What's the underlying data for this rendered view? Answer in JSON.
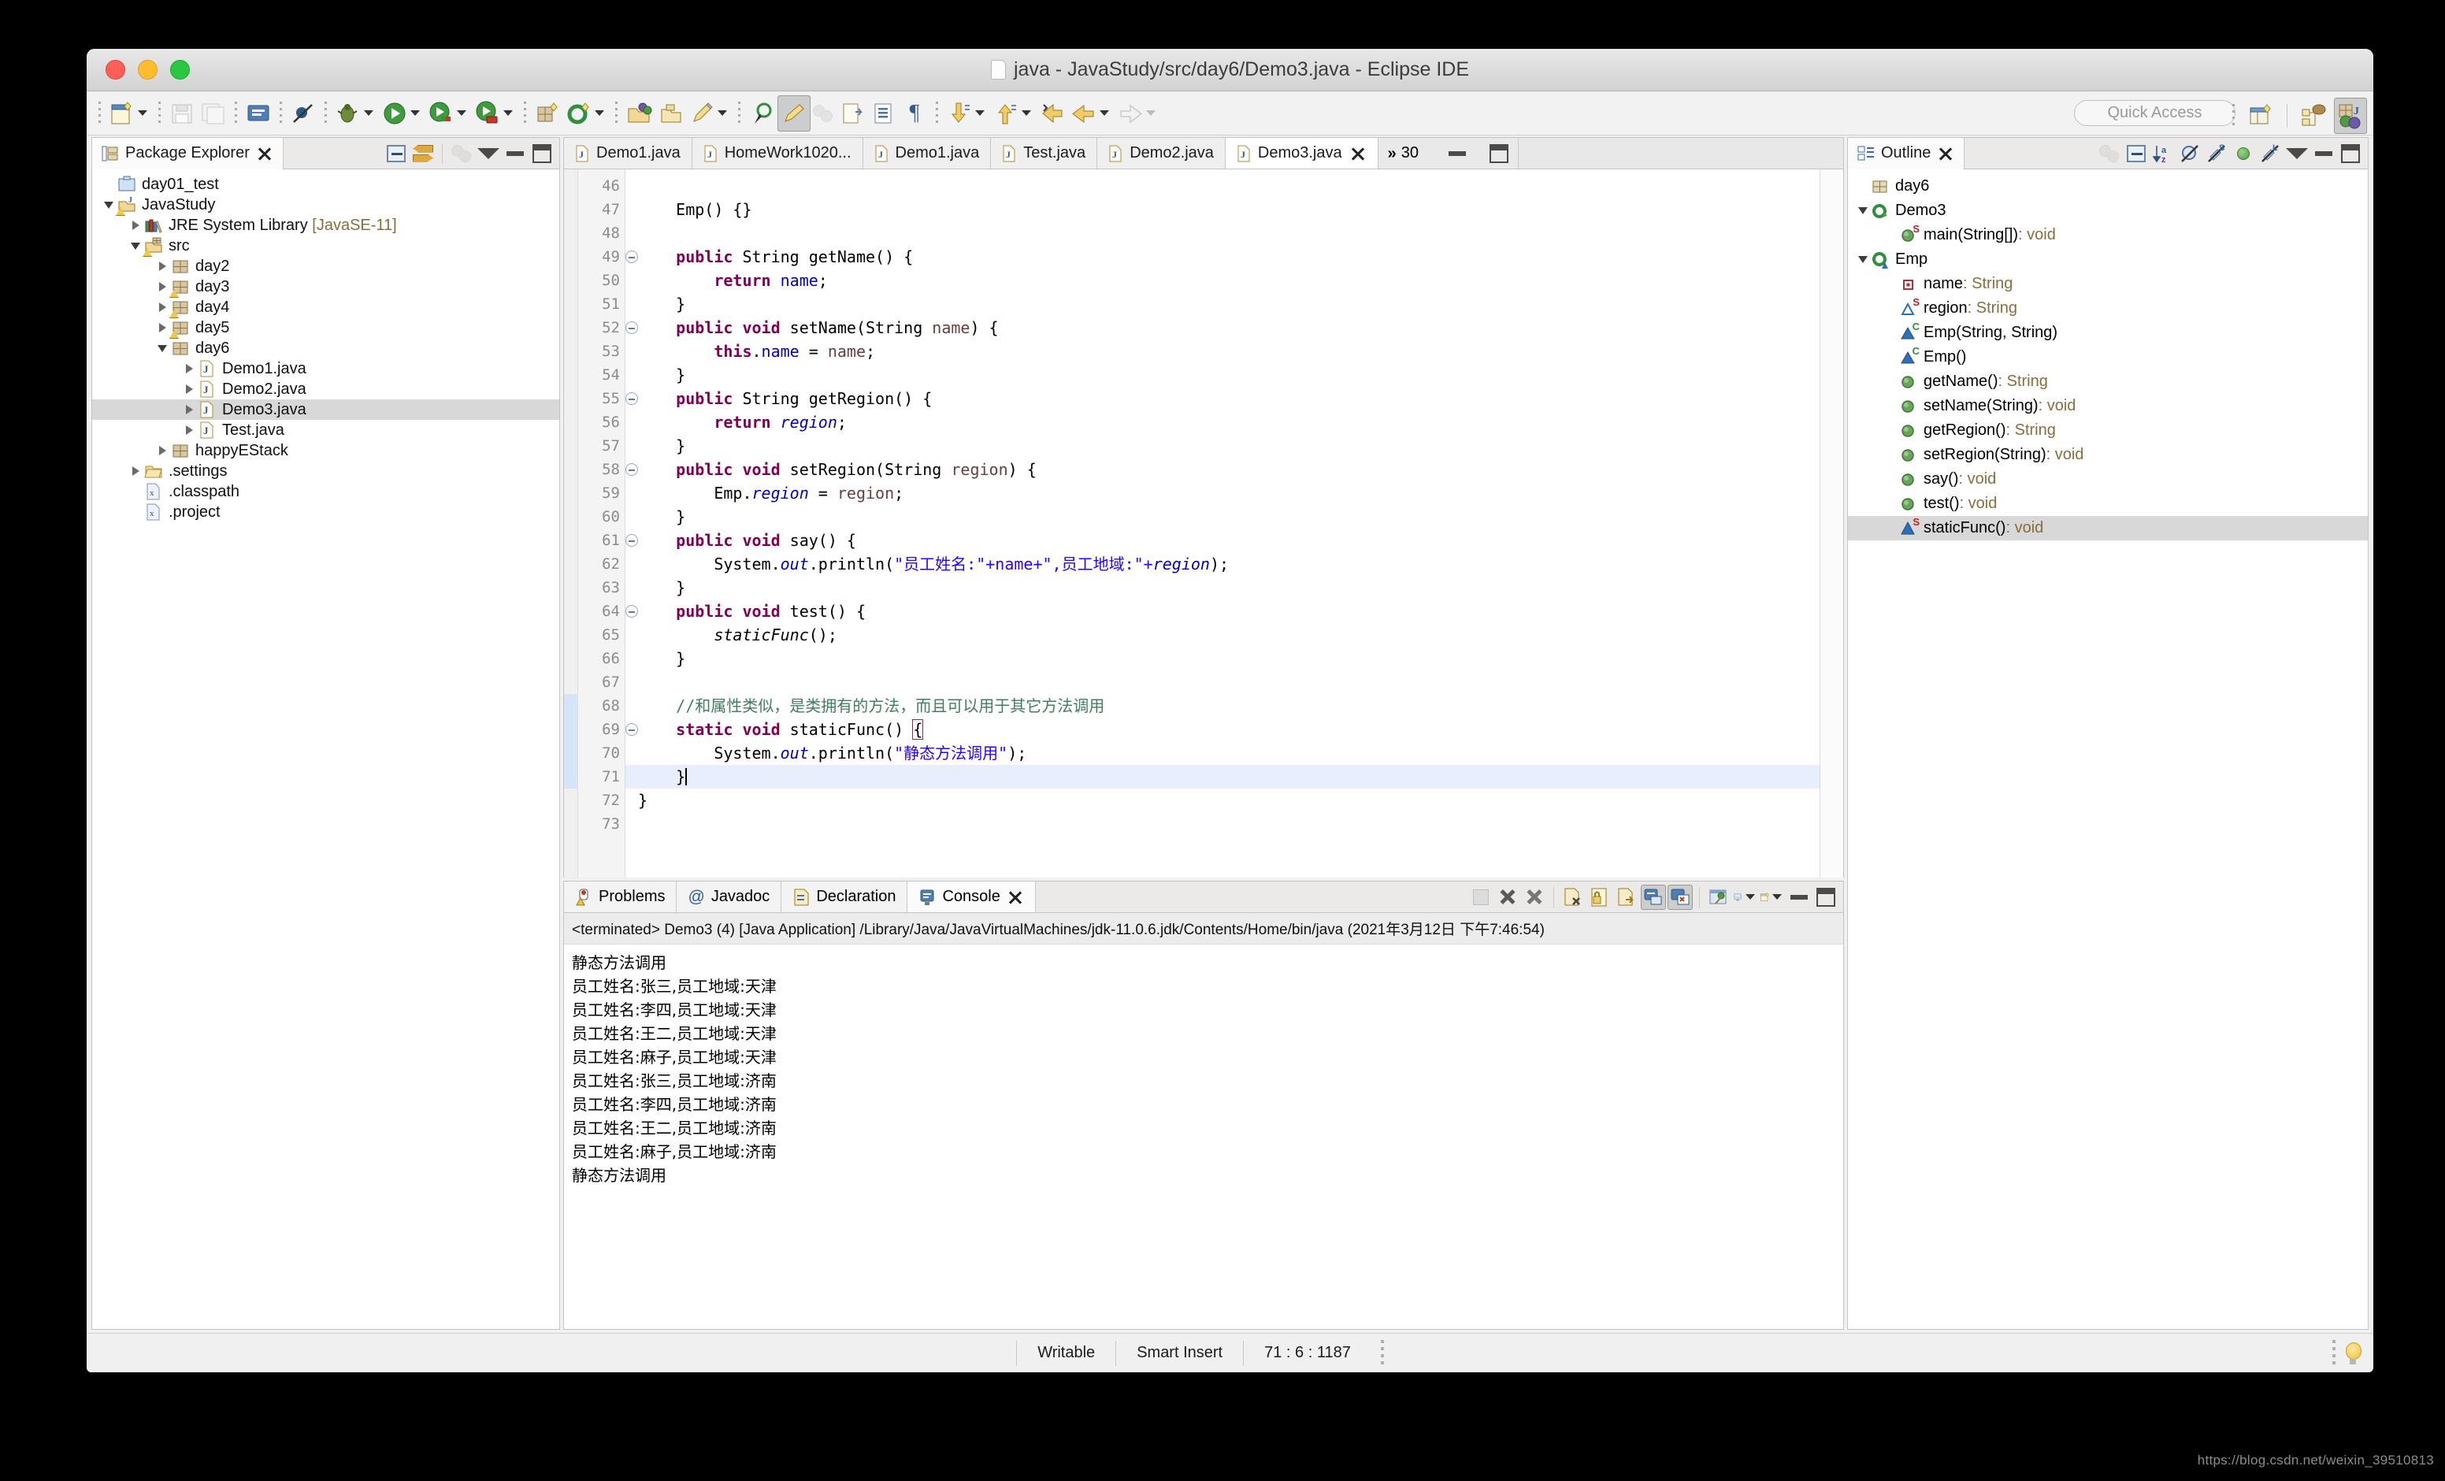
{
  "window": {
    "title": "java - JavaStudy/src/day6/Demo3.java - Eclipse IDE",
    "traffic": {
      "close": "close-window",
      "minimize": "minimize-window",
      "zoom": "zoom-window"
    }
  },
  "toolbar": {
    "quick_access_placeholder": "Quick Access",
    "items": [
      {
        "name": "new-wizard",
        "has_dropdown": true
      },
      {
        "name": "save",
        "has_dropdown": false
      },
      {
        "name": "save-all",
        "has_dropdown": false
      },
      {
        "name": "print",
        "has_dropdown": false
      },
      {
        "name": "toggle-breakpoints",
        "has_dropdown": false
      },
      {
        "name": "debug",
        "has_dropdown": true
      },
      {
        "name": "run",
        "has_dropdown": true
      },
      {
        "name": "run-configurations",
        "has_dropdown": true
      },
      {
        "name": "coverage",
        "has_dropdown": true
      },
      {
        "name": "new-java-package",
        "has_dropdown": false
      },
      {
        "name": "new-java-class",
        "has_dropdown": true
      },
      {
        "name": "open-type",
        "has_dropdown": false
      },
      {
        "name": "open-task",
        "has_dropdown": false
      },
      {
        "name": "external-tools",
        "has_dropdown": true
      },
      {
        "name": "search",
        "has_dropdown": false
      },
      {
        "name": "toggle-mark-occurrences",
        "has_dropdown": false
      },
      {
        "name": "skip-all-breakpoints",
        "has_dropdown": false
      },
      {
        "name": "next-annotation",
        "has_dropdown": true
      },
      {
        "name": "previous-annotation",
        "has_dropdown": true
      },
      {
        "name": "last-edit-location",
        "has_dropdown": false
      },
      {
        "name": "back",
        "has_dropdown": true
      },
      {
        "name": "forward",
        "has_dropdown": true
      }
    ],
    "perspective": [
      {
        "name": "open-perspective"
      },
      {
        "name": "perspective-java-browsing"
      },
      {
        "name": "perspective-java",
        "active": true
      }
    ]
  },
  "package_explorer": {
    "tab_label": "Package Explorer",
    "tools": [
      "collapse-all",
      "link-with-editor",
      "focus-on-active-task",
      "view-menu",
      "minimize",
      "maximize"
    ],
    "tree": [
      {
        "label": "day01_test",
        "indent": 1,
        "twist": "none",
        "icon": "folder-project",
        "warn": false
      },
      {
        "label": "JavaStudy",
        "indent": 1,
        "twist": "down",
        "icon": "java-project",
        "warn": true
      },
      {
        "label": "JRE System Library",
        "sub": "[JavaSE-11]",
        "indent": 2,
        "twist": "right",
        "icon": "jre-library",
        "warn": false
      },
      {
        "label": "src",
        "indent": 2,
        "twist": "down",
        "icon": "source-folder",
        "warn": true
      },
      {
        "label": "day2",
        "indent": 3,
        "twist": "right",
        "icon": "package",
        "warn": false
      },
      {
        "label": "day3",
        "indent": 3,
        "twist": "right",
        "icon": "package",
        "warn": true
      },
      {
        "label": "day4",
        "indent": 3,
        "twist": "right",
        "icon": "package",
        "warn": true
      },
      {
        "label": "day5",
        "indent": 3,
        "twist": "right",
        "icon": "package",
        "warn": true
      },
      {
        "label": "day6",
        "indent": 3,
        "twist": "down",
        "icon": "package",
        "warn": false
      },
      {
        "label": "Demo1.java",
        "indent": 4,
        "twist": "right",
        "icon": "java-file",
        "warn": false
      },
      {
        "label": "Demo2.java",
        "indent": 4,
        "twist": "right",
        "icon": "java-file",
        "warn": false
      },
      {
        "label": "Demo3.java",
        "indent": 4,
        "twist": "right",
        "icon": "java-file",
        "warn": false,
        "selected": true
      },
      {
        "label": "Test.java",
        "indent": 4,
        "twist": "right",
        "icon": "java-file",
        "warn": false
      },
      {
        "label": "happyEStack",
        "indent": 3,
        "twist": "right",
        "icon": "package",
        "warn": false
      },
      {
        "label": ".settings",
        "indent": 2,
        "twist": "right",
        "icon": "folder-open",
        "warn": false
      },
      {
        "label": ".classpath",
        "indent": 2,
        "twist": "none",
        "icon": "xml-file",
        "warn": false
      },
      {
        "label": ".project",
        "indent": 2,
        "twist": "none",
        "icon": "xml-file",
        "warn": false
      }
    ]
  },
  "editor": {
    "tabs": [
      {
        "label": "Demo1.java",
        "active": false,
        "closable": false
      },
      {
        "label": "HomeWork1020...",
        "active": false,
        "closable": false
      },
      {
        "label": "Demo1.java",
        "active": false,
        "closable": false
      },
      {
        "label": "Test.java",
        "active": false,
        "closable": false
      },
      {
        "label": "Demo2.java",
        "active": false,
        "closable": false
      },
      {
        "label": "Demo3.java",
        "active": true,
        "closable": true
      }
    ],
    "overflow_count": "30",
    "window_buttons": [
      "minimize",
      "maximize"
    ],
    "first_line_number": 46,
    "lines": [
      {
        "n": 46,
        "fold": false,
        "text": ""
      },
      {
        "n": 47,
        "fold": false,
        "tokens": [
          {
            "t": "    Emp() {}",
            "c": "ob"
          }
        ]
      },
      {
        "n": 48,
        "fold": false,
        "text": ""
      },
      {
        "n": 49,
        "fold": true,
        "tokens": [
          {
            "t": "    ",
            "c": "ob"
          },
          {
            "t": "public",
            "c": "k"
          },
          {
            "t": " String getName() {",
            "c": "ob"
          }
        ]
      },
      {
        "n": 50,
        "fold": false,
        "tokens": [
          {
            "t": "        ",
            "c": "ob"
          },
          {
            "t": "return",
            "c": "k"
          },
          {
            "t": " ",
            "c": "ob"
          },
          {
            "t": "name",
            "c": "f"
          },
          {
            "t": ";",
            "c": "ob"
          }
        ]
      },
      {
        "n": 51,
        "fold": false,
        "tokens": [
          {
            "t": "    }",
            "c": "ob"
          }
        ]
      },
      {
        "n": 52,
        "fold": true,
        "tokens": [
          {
            "t": "    ",
            "c": "ob"
          },
          {
            "t": "public void",
            "c": "k"
          },
          {
            "t": " setName(String ",
            "c": "ob"
          },
          {
            "t": "name",
            "c": "p"
          },
          {
            "t": ") {",
            "c": "ob"
          }
        ]
      },
      {
        "n": 53,
        "fold": false,
        "tokens": [
          {
            "t": "        ",
            "c": "ob"
          },
          {
            "t": "this",
            "c": "k"
          },
          {
            "t": ".",
            "c": "ob"
          },
          {
            "t": "name",
            "c": "f"
          },
          {
            "t": " = ",
            "c": "ob"
          },
          {
            "t": "name",
            "c": "p"
          },
          {
            "t": ";",
            "c": "ob"
          }
        ]
      },
      {
        "n": 54,
        "fold": false,
        "tokens": [
          {
            "t": "    }",
            "c": "ob"
          }
        ]
      },
      {
        "n": 55,
        "fold": true,
        "tokens": [
          {
            "t": "    ",
            "c": "ob"
          },
          {
            "t": "public",
            "c": "k"
          },
          {
            "t": " String getRegion() {",
            "c": "ob"
          }
        ]
      },
      {
        "n": 56,
        "fold": false,
        "tokens": [
          {
            "t": "        ",
            "c": "ob"
          },
          {
            "t": "return",
            "c": "k"
          },
          {
            "t": " ",
            "c": "ob"
          },
          {
            "t": "region",
            "c": "fi"
          },
          {
            "t": ";",
            "c": "ob"
          }
        ]
      },
      {
        "n": 57,
        "fold": false,
        "tokens": [
          {
            "t": "    }",
            "c": "ob"
          }
        ]
      },
      {
        "n": 58,
        "fold": true,
        "tokens": [
          {
            "t": "    ",
            "c": "ob"
          },
          {
            "t": "public void",
            "c": "k"
          },
          {
            "t": " setRegion(String ",
            "c": "ob"
          },
          {
            "t": "region",
            "c": "p"
          },
          {
            "t": ") {",
            "c": "ob"
          }
        ]
      },
      {
        "n": 59,
        "fold": false,
        "tokens": [
          {
            "t": "        Emp.",
            "c": "ob"
          },
          {
            "t": "region",
            "c": "fi"
          },
          {
            "t": " = ",
            "c": "ob"
          },
          {
            "t": "region",
            "c": "p"
          },
          {
            "t": ";",
            "c": "ob"
          }
        ]
      },
      {
        "n": 60,
        "fold": false,
        "tokens": [
          {
            "t": "    }",
            "c": "ob"
          }
        ]
      },
      {
        "n": 61,
        "fold": true,
        "tokens": [
          {
            "t": "    ",
            "c": "ob"
          },
          {
            "t": "public void",
            "c": "k"
          },
          {
            "t": " say() {",
            "c": "ob"
          }
        ]
      },
      {
        "n": 62,
        "fold": false,
        "tokens": [
          {
            "t": "        System.",
            "c": "ob"
          },
          {
            "t": "out",
            "c": "fi"
          },
          {
            "t": ".println(",
            "c": "ob"
          },
          {
            "t": "\"员工姓名:\"",
            "c": "s"
          },
          {
            "t": "+name+",
            "c": "s"
          },
          {
            "t": "\",员工地域:\"",
            "c": "s"
          },
          {
            "t": "+",
            "c": "s"
          },
          {
            "t": "region",
            "c": "fi"
          },
          {
            "t": ");",
            "c": "ob"
          }
        ]
      },
      {
        "n": 63,
        "fold": false,
        "tokens": [
          {
            "t": "    }",
            "c": "ob"
          }
        ]
      },
      {
        "n": 64,
        "fold": true,
        "tokens": [
          {
            "t": "    ",
            "c": "ob"
          },
          {
            "t": "public void",
            "c": "k"
          },
          {
            "t": " test() {",
            "c": "ob"
          }
        ]
      },
      {
        "n": 65,
        "fold": false,
        "tokens": [
          {
            "t": "        ",
            "c": "ob"
          },
          {
            "t": "staticFunc",
            "c": "mi"
          },
          {
            "t": "();",
            "c": "ob"
          }
        ]
      },
      {
        "n": 66,
        "fold": false,
        "tokens": [
          {
            "t": "    }",
            "c": "ob"
          }
        ]
      },
      {
        "n": 67,
        "fold": false,
        "text": ""
      },
      {
        "n": 68,
        "fold": false,
        "changed": true,
        "tokens": [
          {
            "t": "    //和属性类似，是类拥有的方法，而且可以用于其它方法调用",
            "c": "cm"
          }
        ]
      },
      {
        "n": 69,
        "fold": true,
        "changed": true,
        "tokens": [
          {
            "t": "    ",
            "c": "ob"
          },
          {
            "t": "static void",
            "c": "k"
          },
          {
            "t": " staticFunc() ",
            "c": "ob"
          },
          {
            "t": "{",
            "c": "brace"
          }
        ]
      },
      {
        "n": 70,
        "fold": false,
        "changed": true,
        "tokens": [
          {
            "t": "        System.",
            "c": "ob"
          },
          {
            "t": "out",
            "c": "fi"
          },
          {
            "t": ".println(",
            "c": "ob"
          },
          {
            "t": "\"静态方法调用\"",
            "c": "s"
          },
          {
            "t": ");",
            "c": "ob"
          }
        ]
      },
      {
        "n": 71,
        "fold": false,
        "changed": true,
        "highlight": true,
        "caret": true,
        "tokens": [
          {
            "t": "    }",
            "c": "ob"
          }
        ]
      },
      {
        "n": 72,
        "fold": false,
        "tokens": [
          {
            "t": "}",
            "c": "ob"
          }
        ]
      },
      {
        "n": 73,
        "fold": false,
        "text": ""
      }
    ]
  },
  "outline": {
    "tab_label": "Outline",
    "tools": [
      "focus-on-active-task",
      "collapse-all",
      "sort",
      "hide-fields",
      "hide-static",
      "hide-non-public",
      "hide-local-types",
      "view-menu",
      "minimize",
      "maximize"
    ],
    "items": [
      {
        "label": "day6",
        "type": "",
        "indent": 0,
        "twist": "none",
        "icon": "package",
        "sup": ""
      },
      {
        "label": "Demo3",
        "type": "",
        "indent": 0,
        "twist": "down",
        "icon": "class-public",
        "sup": ""
      },
      {
        "label": "main(String[])",
        "type": " : void",
        "indent": 1,
        "twist": "none",
        "icon": "method-public",
        "sup": "S"
      },
      {
        "label": "Emp",
        "type": "",
        "indent": 0,
        "twist": "down",
        "icon": "class-default",
        "sup": ""
      },
      {
        "label": "name",
        "type": " : String",
        "indent": 1,
        "twist": "none",
        "icon": "field-private",
        "sup": ""
      },
      {
        "label": "region",
        "type": " : String",
        "indent": 1,
        "twist": "none",
        "icon": "field-default",
        "sup": "S"
      },
      {
        "label": "Emp(String, String)",
        "type": "",
        "indent": 1,
        "twist": "none",
        "icon": "constructor-default",
        "sup": "C"
      },
      {
        "label": "Emp()",
        "type": "",
        "indent": 1,
        "twist": "none",
        "icon": "constructor-default",
        "sup": "C"
      },
      {
        "label": "getName()",
        "type": " : String",
        "indent": 1,
        "twist": "none",
        "icon": "method-public",
        "sup": ""
      },
      {
        "label": "setName(String)",
        "type": " : void",
        "indent": 1,
        "twist": "none",
        "icon": "method-public",
        "sup": ""
      },
      {
        "label": "getRegion()",
        "type": " : String",
        "indent": 1,
        "twist": "none",
        "icon": "method-public",
        "sup": ""
      },
      {
        "label": "setRegion(String)",
        "type": " : void",
        "indent": 1,
        "twist": "none",
        "icon": "method-public",
        "sup": ""
      },
      {
        "label": "say()",
        "type": " : void",
        "indent": 1,
        "twist": "none",
        "icon": "method-public",
        "sup": ""
      },
      {
        "label": "test()",
        "type": " : void",
        "indent": 1,
        "twist": "none",
        "icon": "method-public",
        "sup": ""
      },
      {
        "label": "staticFunc()",
        "type": " : void",
        "indent": 1,
        "twist": "none",
        "icon": "method-default",
        "sup": "S",
        "selected": true
      }
    ]
  },
  "console": {
    "tabs": [
      {
        "label": "Problems",
        "icon": "problems-icon",
        "active": false
      },
      {
        "label": "Javadoc",
        "icon": "javadoc-icon",
        "active": false
      },
      {
        "label": "Declaration",
        "icon": "declaration-icon",
        "active": false
      },
      {
        "label": "Console",
        "icon": "console-icon",
        "active": true
      }
    ],
    "tools": [
      "terminate-disabled",
      "remove-launch",
      "remove-all-terminated",
      "clear-console",
      "lock-scroll",
      "show-console-on-output",
      "pin-console",
      "display-selected-console",
      "open-console",
      "minimize",
      "maximize"
    ],
    "launch_header": "<terminated> Demo3 (4) [Java Application] /Library/Java/JavaVirtualMachines/jdk-11.0.6.jdk/Contents/Home/bin/java (2021年3月12日 下午7:46:54)",
    "output": [
      "静态方法调用",
      "员工姓名:张三,员工地域:天津",
      "员工姓名:李四,员工地域:天津",
      "员工姓名:王二,员工地域:天津",
      "员工姓名:麻子,员工地域:天津",
      "员工姓名:张三,员工地域:济南",
      "员工姓名:李四,员工地域:济南",
      "员工姓名:王二,员工地域:济南",
      "员工姓名:麻子,员工地域:济南",
      "静态方法调用"
    ]
  },
  "statusbar": {
    "writable": "Writable",
    "insert_mode": "Smart Insert",
    "position": "71 : 6 : 1187",
    "bulb": "quick-fix-bulb"
  },
  "watermark": "https://blog.csdn.net/weixin_39510813",
  "colors": {
    "keyword": "#7f0055",
    "string": "#2a00ff",
    "comment": "#3f7f5f",
    "field": "#0000c0",
    "parameter": "#6a3e3e",
    "type_annotation": "#8a6d3b",
    "selection": "#d8d8d8",
    "current_line": "#e8eefb"
  }
}
